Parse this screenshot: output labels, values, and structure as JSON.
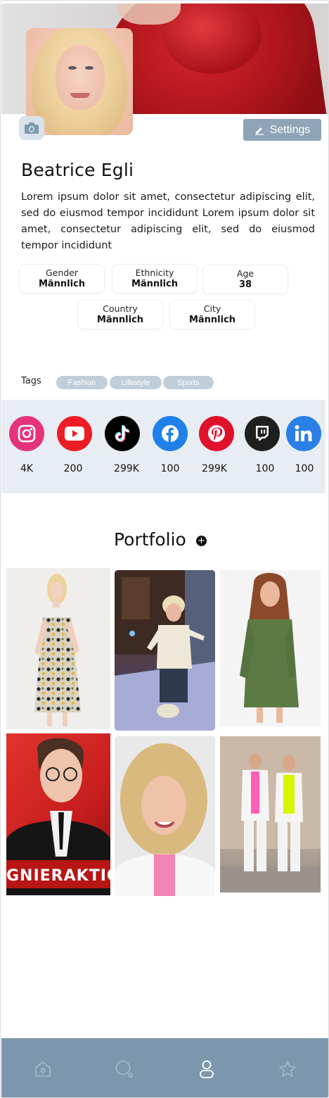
{
  "profile": {
    "name": "Beatrice Egli",
    "bio": "Lorem ipsum dolor sit amet, consectetur adipiscing elit, sed do eiusmod tempor incididunt Lorem ipsum dolor sit amet, consectetur adipiscing elit, sed do eiusmod tempor incididunt"
  },
  "header": {
    "settings_label": "Settings",
    "settings_icon": "pencil-icon",
    "camera_icon": "camera-icon"
  },
  "details": [
    {
      "label": "Gender",
      "value": "Männlich"
    },
    {
      "label": "Ethnicity",
      "value": "Männlich"
    },
    {
      "label": "Age",
      "value": "38"
    },
    {
      "label": "Country",
      "value": "Männlich"
    },
    {
      "label": "City",
      "value": "Männlich"
    }
  ],
  "tags": {
    "label": "Tags",
    "items": [
      "Fashion",
      "Lifestyle",
      "Sports"
    ]
  },
  "socials": [
    {
      "network": "instagram",
      "icon": "instagram-icon",
      "count": "4K",
      "color": "#e4337a"
    },
    {
      "network": "youtube",
      "icon": "youtube-icon",
      "count": "200",
      "color": "#ee1c25"
    },
    {
      "network": "tiktok",
      "icon": "tiktok-icon",
      "count": "299K",
      "color": "#000000"
    },
    {
      "network": "facebook",
      "icon": "facebook-icon",
      "count": "100",
      "color": "#1f80e8"
    },
    {
      "network": "pinterest",
      "icon": "pinterest-icon",
      "count": "299K",
      "color": "#e0112b"
    },
    {
      "network": "twitch",
      "icon": "twitch-icon",
      "count": "100",
      "color": "#1f1f1f"
    },
    {
      "network": "linkedin",
      "icon": "linkedin-icon",
      "count": "100",
      "color": "#2a7fe8"
    }
  ],
  "portfolio": {
    "title": "Portfolio",
    "add_icon": "plus-icon",
    "photo_caption_4": "GNIERAKTIO"
  },
  "nav": [
    {
      "name": "home",
      "icon": "home-icon",
      "active": false
    },
    {
      "name": "search",
      "icon": "search-icon",
      "active": false
    },
    {
      "name": "profile",
      "icon": "user-icon",
      "active": true
    },
    {
      "name": "favorites",
      "icon": "star-icon",
      "active": false
    }
  ],
  "colors": {
    "accent": "#8fa4b6",
    "tag_bg": "#c0ced9",
    "social_band": "#e7edf2",
    "nav_bg": "#7c97ad"
  }
}
